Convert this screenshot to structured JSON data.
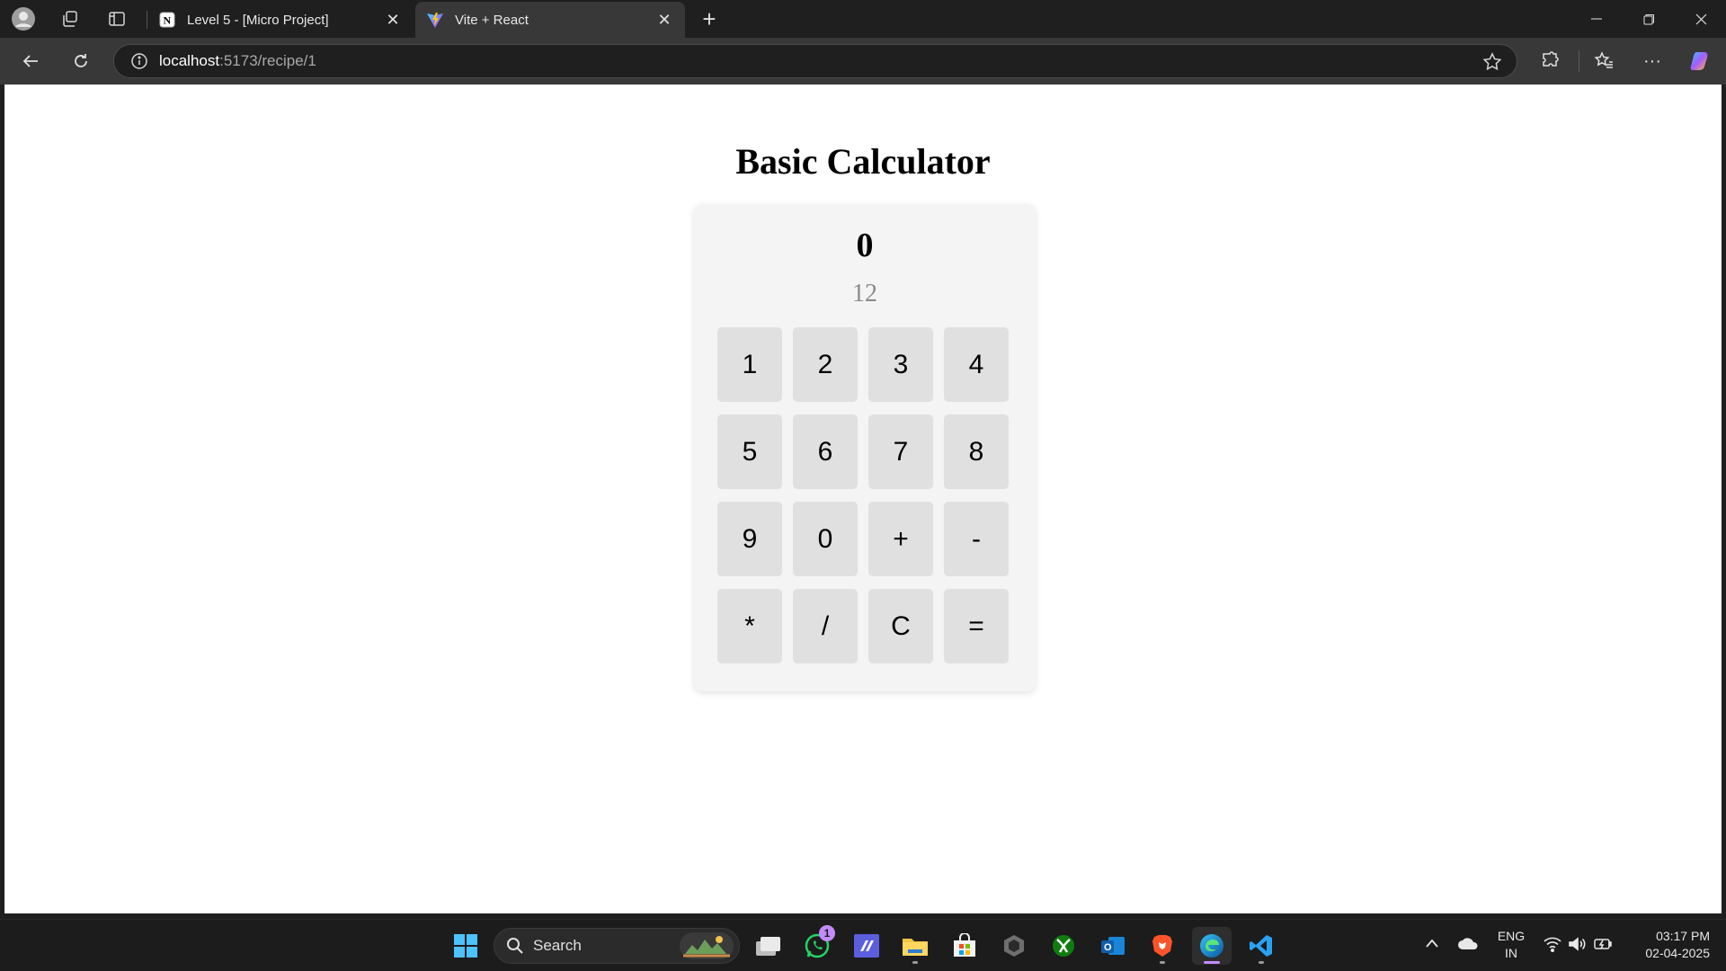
{
  "browser": {
    "tabs": [
      {
        "title": "Level 5 - [Micro Project]",
        "active": false,
        "favicon": "notion-icon"
      },
      {
        "title": "Vite + React",
        "active": true,
        "favicon": "vite-icon"
      }
    ],
    "url_host": "localhost",
    "url_rest": ":5173/recipe/1"
  },
  "page": {
    "heading": "Basic Calculator",
    "result": "0",
    "expression": "12",
    "keys": [
      "1",
      "2",
      "3",
      "4",
      "5",
      "6",
      "7",
      "8",
      "9",
      "0",
      "+",
      "-",
      "*",
      "/",
      "C",
      "="
    ]
  },
  "taskbar": {
    "search_label": "Search",
    "whatsapp_badge": "1",
    "language_line1": "ENG",
    "language_line2": "IN",
    "time": "03:17 PM",
    "date": "02-04-2025"
  },
  "colors": {
    "accent": "#c38bff",
    "key_bg": "#e0e0e0",
    "calc_bg": "#f4f4f4"
  }
}
